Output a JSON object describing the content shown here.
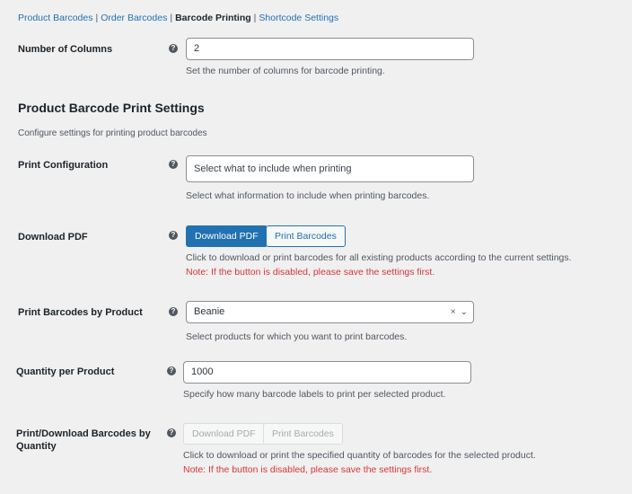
{
  "subnav": {
    "items": [
      "Product Barcodes",
      "Order Barcodes",
      "Barcode Printing",
      "Shortcode Settings"
    ],
    "separator": "|"
  },
  "help_icon_glyph": "?",
  "columns": {
    "label": "Number of Columns",
    "value": "2",
    "desc": "Set the number of columns for barcode printing."
  },
  "section": {
    "title": "Product Barcode Print Settings",
    "desc": "Configure settings for printing product barcodes"
  },
  "print_config": {
    "label": "Print Configuration",
    "placeholder": "Select what to include when printing",
    "desc": "Select what information to include when printing barcodes."
  },
  "download_pdf": {
    "label": "Download PDF",
    "download_button": "Download PDF",
    "print_button": "Print Barcodes",
    "desc": "Click to download or print barcodes for all existing products according to the current settings.",
    "note": "Note: If the button is disabled, please save the settings first."
  },
  "by_product": {
    "label": "Print Barcodes by Product",
    "value": "Beanie",
    "clear_glyph": "×",
    "dropdown_glyph": "⌄",
    "desc": "Select products for which you want to print barcodes."
  },
  "quantity": {
    "label": "Quantity per Product",
    "value": "1000",
    "desc": "Specify how many barcode labels to print per selected product."
  },
  "by_quantity": {
    "label_line1": "Print/Download Barcodes by",
    "label_line2": "Quantity",
    "download_button": "Download PDF",
    "print_button": "Print Barcodes",
    "desc": "Click to download or print the specified quantity of barcodes for the selected product.",
    "note": "Note: If the button is disabled, please save the settings first."
  },
  "colors": {
    "background": "#f0f0f1",
    "link": "#2271b1",
    "primary": "#2271b1",
    "note": "#d63638"
  }
}
